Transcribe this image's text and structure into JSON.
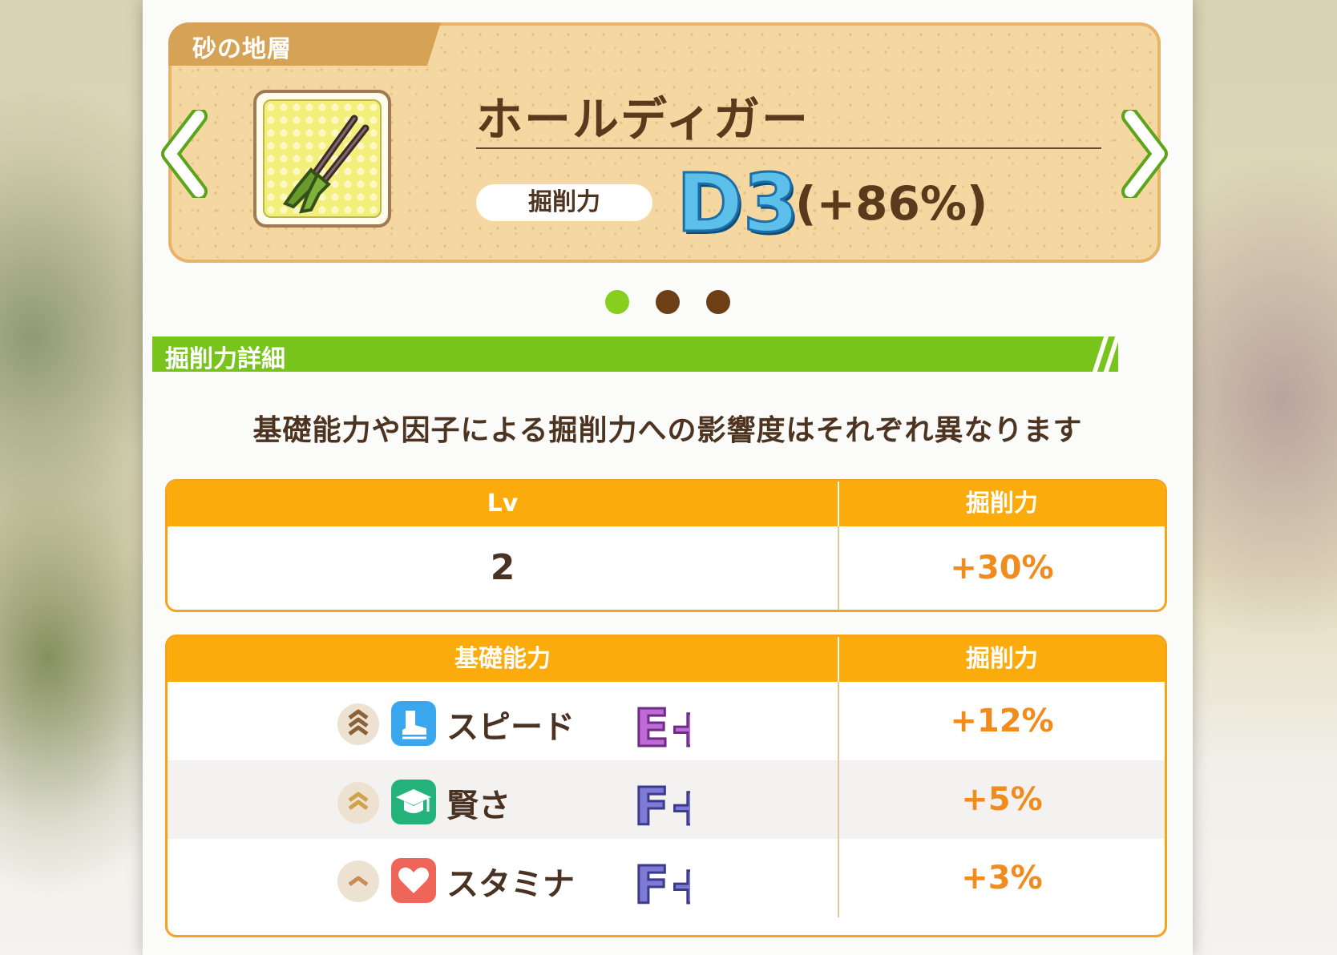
{
  "stratum_label": "砂の地層",
  "item": {
    "name": "ホールディガー",
    "stat_label": "掘削力",
    "rank": "D3",
    "rank_bonus": "(+86%)"
  },
  "pagination": {
    "count": 3,
    "active_index": 0
  },
  "section_title": "掘削力詳細",
  "description": "基礎能力や因子による掘削力への影響度はそれぞれ異なります",
  "level_table": {
    "headers": [
      "Lv",
      "掘削力"
    ],
    "rows": [
      {
        "lv": "2",
        "bonus": "+30%"
      }
    ]
  },
  "ability_table": {
    "headers": [
      "基礎能力",
      "掘削力"
    ],
    "rows": [
      {
        "name": "スピード",
        "icon": "shoe-icon",
        "icon_color": "#3aa6ee",
        "grade": "E+",
        "grade_color": "#c06ad6",
        "chevrons": 3,
        "bonus": "+12%"
      },
      {
        "name": "賢さ",
        "icon": "graduation-cap-icon",
        "icon_color": "#22b27a",
        "grade": "F+",
        "grade_color": "#7e7bd6",
        "chevrons": 2,
        "bonus": "+5%"
      },
      {
        "name": "スタミナ",
        "icon": "heart-icon",
        "icon_color": "#f0655a",
        "grade": "F+",
        "grade_color": "#7e7bd6",
        "chevrons": 1,
        "bonus": "+3%"
      }
    ]
  },
  "colors": {
    "accent_green": "#79c31d",
    "table_orange": "#fbab0c",
    "bonus_orange": "#f08b1e",
    "text_brown": "#4a3222"
  }
}
